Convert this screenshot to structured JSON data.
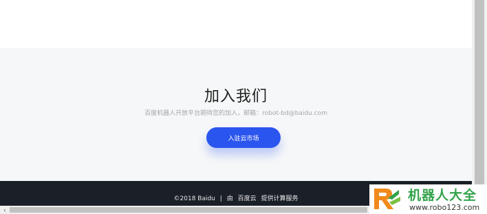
{
  "join": {
    "title": "加入我们",
    "desc_prefix": "百度机器人开放平台期待您的加入，邮箱：",
    "email": "robot-bd@baidu.com",
    "button_label": "入驻云市场"
  },
  "footer": {
    "copyright": "©2018 Baidu",
    "separator": "|",
    "provider_prefix": "由",
    "provider_name": "百度云",
    "provider_suffix": "提供计算服务"
  },
  "scrollbar": {
    "left_arrow": "‹"
  },
  "watermark": {
    "logo_icon": "robo123-logo-icon",
    "name": "机器人大全",
    "url": "www.robo123.com"
  },
  "colors": {
    "accent": "#2b55ef",
    "section_bg": "#f6f7f8",
    "footer_bg": "#1b1f27",
    "watermark_green": "#33a34b"
  }
}
